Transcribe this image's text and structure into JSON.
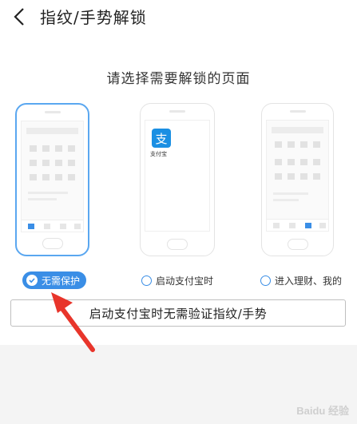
{
  "header": {
    "back_icon": "chevron-left-icon",
    "title": "指纹/手势解锁"
  },
  "subtitle": "请选择需要解锁的页面",
  "options": [
    {
      "label": "无需保护",
      "selected": true
    },
    {
      "label": "启动支付宝时",
      "selected": false
    },
    {
      "label": "进入理财、我的",
      "selected": false
    }
  ],
  "previews": {
    "alipay_icon_glyph": "支",
    "alipay_name": "支付宝"
  },
  "wide_button": {
    "label": "启动支付宝时无需验证指纹/手势"
  },
  "watermark": "Baidu 经验",
  "colors": {
    "accent": "#3a8ee6",
    "arrow": "#e8352b"
  }
}
